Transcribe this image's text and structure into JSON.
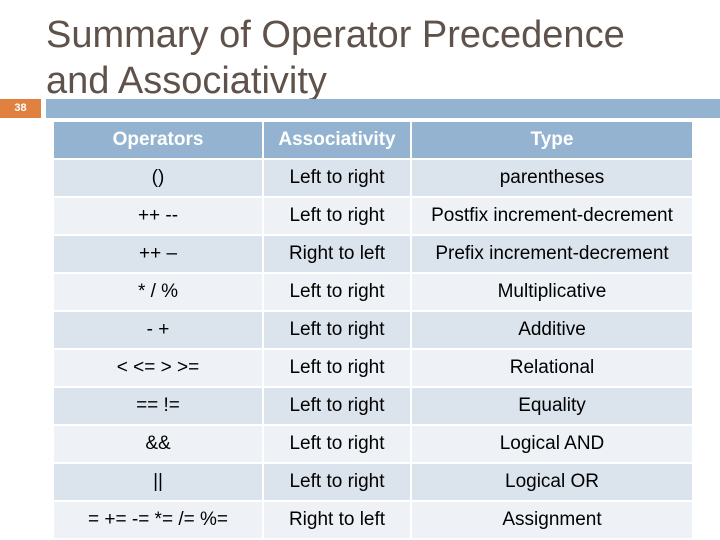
{
  "slide": {
    "title": "Summary of Operator Precedence\n and Associativity",
    "number": "38",
    "colors": {
      "accent": "#e0813f",
      "header": "#93b3d1",
      "row_dark": "#dbe3ec",
      "row_light": "#eef2f7",
      "title": "#5f524b"
    }
  },
  "table": {
    "headers": [
      "Operators",
      "Associativity",
      "Type"
    ],
    "rows": [
      [
        "()",
        "Left to right",
        "parentheses"
      ],
      [
        "++  --",
        "Left to right",
        "Postfix increment-decrement"
      ],
      [
        "++ –",
        "Right to left",
        "Prefix increment-decrement"
      ],
      [
        "* / %",
        "Left to right",
        "Multiplicative"
      ],
      [
        "- +",
        "Left to right",
        "Additive"
      ],
      [
        "< <= > >=",
        "Left to right",
        "Relational"
      ],
      [
        "== !=",
        "Left to right",
        "Equality"
      ],
      [
        "&&",
        "Left to right",
        "Logical AND"
      ],
      [
        "||",
        "Left to right",
        "Logical OR"
      ],
      [
        "= += -= *= /= %=",
        "Right to left",
        "Assignment"
      ]
    ]
  }
}
